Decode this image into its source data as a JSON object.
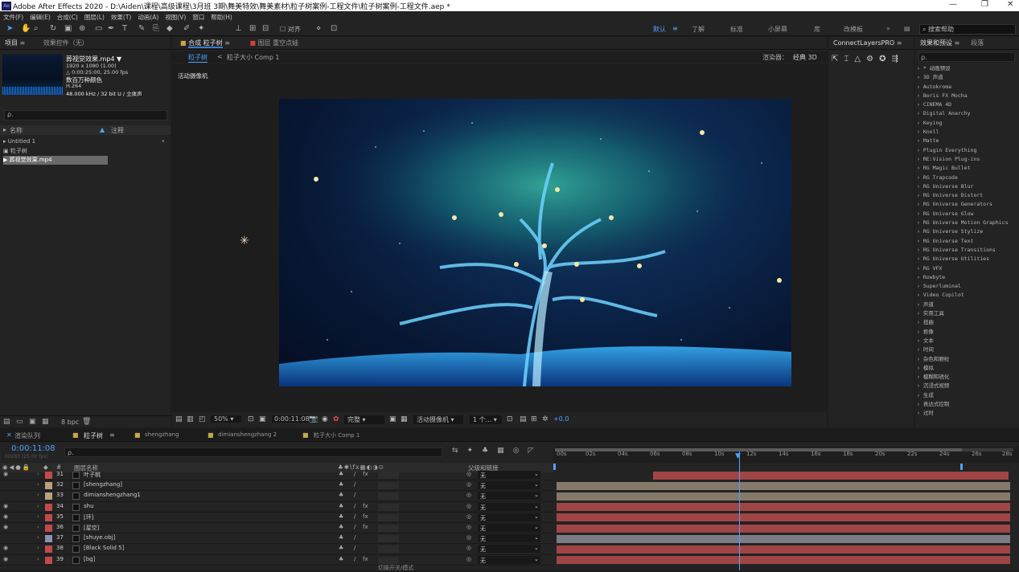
{
  "titlebar": {
    "app_logo": "Ae",
    "title": "Adobe After Effects 2020 - D:\\Aiden\\课程\\高级课程\\3月班 3期\\舞美特效\\舞美素材\\粒子树案例-工程文件\\粒子树案例-工程文件.aep *",
    "minimize": "—",
    "maximize": "❐",
    "close": "✕"
  },
  "menu": [
    "文件(F)",
    "编辑(E)",
    "合成(C)",
    "图层(L)",
    "效果(T)",
    "动画(A)",
    "视图(V)",
    "窗口",
    "帮助(H)"
  ],
  "toolbar": {
    "snap_label": "对齐",
    "workspaces": [
      "默认",
      "了解",
      "标准",
      "小屏幕",
      "库",
      "改模板"
    ],
    "more": "»",
    "search_help": "搜索帮助"
  },
  "project": {
    "tab": "项目",
    "tab_menu": "≡",
    "fx_controls_tab": "效果控件（无）",
    "clip_name": "葬视觉效果.mp4 ▼",
    "clip_res": "1920 x 1080 (1.00)",
    "clip_dur": "△ 0:00:25:00, 25.00 fps",
    "clip_color": "数百万种颜色",
    "clip_codec": "H.264",
    "clip_audio": "48.000 kHz / 32 bit U / 立体声",
    "search_placeholder": "ρ.",
    "col_name": "名称",
    "col_comment": "注释",
    "items": [
      {
        "icon": "▸",
        "name": "Untitled 1"
      },
      {
        "icon": "▣",
        "name": "粒子树"
      },
      {
        "icon": "▶",
        "name": "葬视觉效果.mp4"
      }
    ],
    "bpc": "8 bpc"
  },
  "composition": {
    "tab": "合成 粒子树",
    "tab_menu": "≡",
    "layer_tab": "图层 重空点娃",
    "breadcrumb_1": "粒子树",
    "breadcrumb_sep": "<",
    "breadcrumb_2": "粒子大小 Comp 1",
    "renderer_label": "渲染器：",
    "renderer_value": "经典 3D",
    "camera_label": "活动摄像机",
    "zoom": "50%",
    "timecode": "0:00:11:08",
    "quality": "完整",
    "view": "活动摄像机",
    "views_count": "1 个...",
    "exposure": "+0.0"
  },
  "layers_panel": {
    "tab": "ConnectLayersPRO",
    "tab_menu": "≡"
  },
  "effects": {
    "tab": "效果和预设",
    "tab_menu": "≡",
    "tab2": "段落",
    "search_placeholder": "ρ.",
    "items": [
      "* 动画预设",
      "3D 声道",
      "Autokroma",
      "Boris FX Mocha",
      "CINEMA 4D",
      "Digital Anarchy",
      "Keying",
      "Knoll",
      "Matte",
      "Plugin Everything",
      "RE:Vision Plug-ins",
      "RG Magic Bullet",
      "RG Trapcode",
      "RG Universe Blur",
      "RG Universe Distort",
      "RG Universe Generators",
      "RG Universe Glow",
      "RG Universe Motion Graphics",
      "RG Universe Stylize",
      "RG Universe Text",
      "RG Universe Transitions",
      "RG Universe Utilities",
      "RG VFX",
      "Rowbyte",
      "Superluminal",
      "Video Copilot",
      "声道",
      "实用工具",
      "扭曲",
      "抠像",
      "文本",
      "时间",
      "杂色和颗粒",
      "模拟",
      "模糊和锐化",
      "沉浸式视频",
      "生成",
      "表达式控制",
      "过时"
    ]
  },
  "timeline": {
    "tabs": [
      "渲染队列",
      "粒子树",
      "shengzhang",
      "dimianshengzhang 2",
      "粒子大小 Comp 1"
    ],
    "tab_menu": "≡",
    "timecode": "0:00:11:08",
    "frames": "00283 (25.00 fps)",
    "search_placeholder": "ρ.",
    "col_hash": "#",
    "col_layer": "图层名称",
    "col_parent": "父级和链接",
    "ruler": [
      "00s",
      "02s",
      "04s",
      "06s",
      "08s",
      "10s",
      "12s",
      "14s",
      "16s",
      "18s",
      "20s",
      "22s",
      "24s",
      "26s",
      "28s"
    ],
    "footer": "切换开关/模式",
    "layers": [
      {
        "num": "31",
        "name": "叶子桃",
        "parent": "无",
        "color": "#c24a4a",
        "bar": "#a04545",
        "fx": "fx"
      },
      {
        "num": "32",
        "name": "[shengzhang]",
        "parent": "无",
        "color": "#b8a080",
        "bar": "#857a6a",
        "fx": ""
      },
      {
        "num": "33",
        "name": "dimianshengzhang1",
        "parent": "无",
        "color": "#b8a080",
        "bar": "#857a6a",
        "fx": ""
      },
      {
        "num": "34",
        "name": "shu",
        "parent": "无",
        "color": "#c24a4a",
        "bar": "#a04545",
        "fx": "fx"
      },
      {
        "num": "35",
        "name": "[环]",
        "parent": "无",
        "color": "#c24a4a",
        "bar": "#a04545",
        "fx": "fx"
      },
      {
        "num": "36",
        "name": "[星空]",
        "parent": "无",
        "color": "#c24a4a",
        "bar": "#a04545",
        "fx": "fx"
      },
      {
        "num": "37",
        "name": "[shuye.obj]",
        "parent": "无",
        "color": "#9090b0",
        "bar": "#7c7c88",
        "fx": ""
      },
      {
        "num": "38",
        "name": "[Black Solid 5]",
        "parent": "无",
        "color": "#c24a4a",
        "bar": "#a04545",
        "fx": ""
      },
      {
        "num": "39",
        "name": "[bg]",
        "parent": "无",
        "color": "#c24a4a",
        "bar": "#a04545",
        "fx": "fx"
      }
    ]
  }
}
